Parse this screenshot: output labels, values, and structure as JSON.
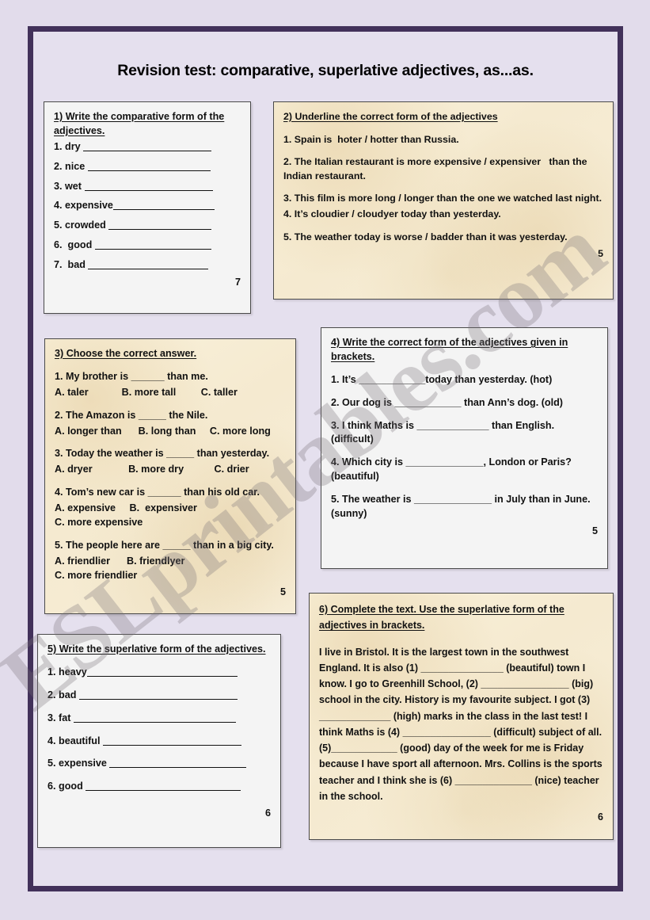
{
  "page": {
    "title": "Revision test: comparative, superlative adjectives, as...as.",
    "watermark": "ESLprintables.com",
    "frame_color": "#42315a",
    "page_background": "#e2dceb",
    "box_cream_color": "#f5ead0",
    "box_white_color": "#f4f4f4"
  },
  "exercises": [
    {
      "id": "ex1",
      "heading": "1) Write the comparative form of the adjectives.",
      "style": "white",
      "items": [
        "1. dry",
        "2. nice",
        "3. wet",
        "4. expensive",
        "5. crowded",
        "6.  good",
        "7.  bad"
      ],
      "score": "7"
    },
    {
      "id": "ex2",
      "heading": "2) Underline the correct form of the adjectives",
      "style": "cream",
      "lines": [
        "1. Spain is  hoter / hotter than Russia.",
        "2. The Italian restaurant is more expensive / expensiver   than the Indian restaurant.",
        "3. This film is more long / longer than the one we watched last night.",
        "4. It’s cloudier / cloudyer today than yesterday.",
        "5. The weather today is worse / badder than it was yesterday."
      ],
      "score": "5"
    },
    {
      "id": "ex3",
      "heading": "3) Choose the correct answer.",
      "style": "cream",
      "questions": [
        {
          "stem": "1. My brother is ______ than me.",
          "options": "A. taler            B. more tall         C. taller"
        },
        {
          "stem": "2. The Amazon is _____ the Nile.",
          "options": "A. longer than      B. long than     C. more long"
        },
        {
          "stem": "3. Today the weather is _____ than yesterday.",
          "options": "A. dryer             B. more dry           C. drier"
        },
        {
          "stem": "4. Tom’s new car is ______ than his old car.",
          "options": "A. expensive     B.  expensiver\nC. more expensive"
        },
        {
          "stem": "5. The people here are _____ than in a big city.",
          "options": "A. friendlier      B. friendlyer\nC. more friendlier"
        }
      ],
      "score": "5"
    },
    {
      "id": "ex4",
      "heading": "4) Write the correct form of the adjectives given in brackets.",
      "style": "white",
      "lines": [
        "1. It’s ____________today than yesterday. (hot)",
        "2. Our dog is ____________ than Ann’s dog. (old)",
        "3. I think Maths is _____________ than English. (difficult)",
        "4. Which city is ______________, London or Paris? (beautiful)",
        "5. The weather is ______________ in July than in June. (sunny)"
      ],
      "score": "5"
    },
    {
      "id": "ex5",
      "heading": "5) Write the superlative form of the adjectives.",
      "style": "white",
      "items": [
        "1. heavy",
        "2. bad",
        "3. fat",
        "4. beautiful",
        "5. expensive",
        "6. good"
      ],
      "score": "6"
    },
    {
      "id": "ex6",
      "heading": "6) Complete the text. Use the superlative form of the adjectives in brackets.",
      "style": "cream",
      "text": "I live in Bristol. It is the largest town in the southwest England. It is also (1) _______________ (beautiful) town I know. I go to Greenhill School, (2) ________________ (big) school in the city. History is my favourite subject. I got (3) _____________ (high) marks in the class in the last test! I think Maths is (4) ________________ (difficult) subject of all. (5)____________ (good) day of the week for me is Friday because I have sport all afternoon. Mrs. Collins is the sports teacher and I think she is (6) ______________ (nice) teacher in the school.",
      "score": "6"
    }
  ]
}
